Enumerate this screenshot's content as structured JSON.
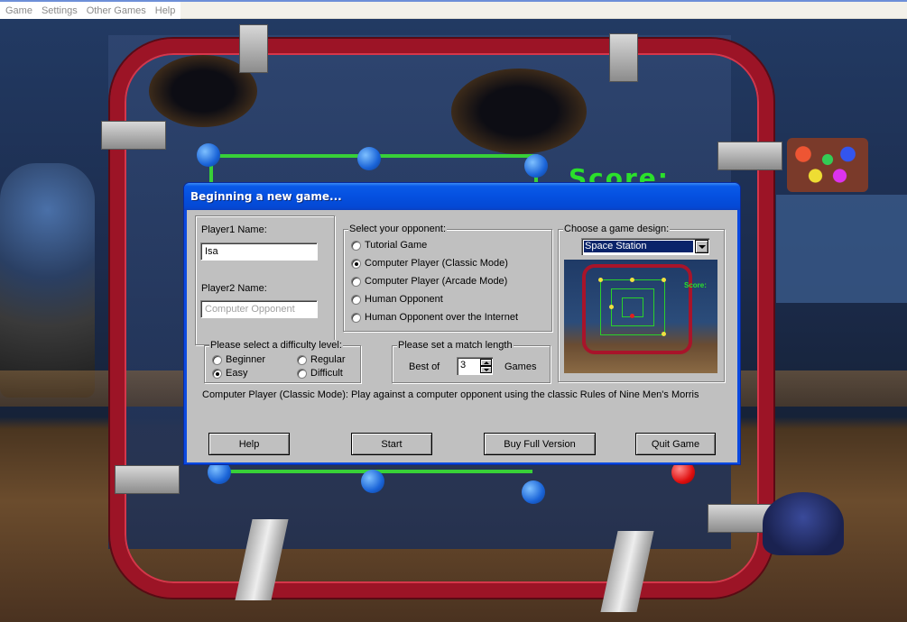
{
  "menu": {
    "items": [
      {
        "label": "Game"
      },
      {
        "label": "Settings"
      },
      {
        "label": "Other Games"
      },
      {
        "label": "Help"
      }
    ]
  },
  "background": {
    "scoreboard_text": "Score:"
  },
  "dialog": {
    "title": "Beginning a new game...",
    "player1_label": "Player1 Name:",
    "player1_value": "Isa",
    "player2_label": "Player2 Name:",
    "player2_placeholder": "Computer Opponent",
    "opponent": {
      "caption": "Select your opponent:",
      "options": [
        {
          "label": "Tutorial Game",
          "selected": false
        },
        {
          "label": "Computer Player (Classic Mode)",
          "selected": true
        },
        {
          "label": "Computer Player (Arcade Mode)",
          "selected": false
        },
        {
          "label": "Human Opponent",
          "selected": false
        },
        {
          "label": "Human Opponent over the Internet",
          "selected": false
        }
      ]
    },
    "design": {
      "caption": "Choose a game design:",
      "selected": "Space Station",
      "preview_text": "Score:"
    },
    "difficulty": {
      "caption": "Please select a difficulty level:",
      "options": [
        {
          "label": "Beginner",
          "selected": false
        },
        {
          "label": "Regular",
          "selected": false
        },
        {
          "label": "Easy",
          "selected": true
        },
        {
          "label": "Difficult",
          "selected": false
        }
      ]
    },
    "match": {
      "caption": "Please set a match length",
      "prefix": "Best of",
      "value": "3",
      "suffix": "Games"
    },
    "description": "Computer Player (Classic Mode): Play against a computer opponent using the classic Rules of Nine Men's Morris",
    "buttons": {
      "help": "Help",
      "start": "Start",
      "buy": "Buy Full Version",
      "quit": "Quit Game"
    }
  },
  "colors": {
    "title_bar": "#0550e0",
    "dialog_face": "#c0c0c0",
    "frame_red": "#9c1426",
    "board_green": "#38d038",
    "peg_blue": "#1a64d8"
  }
}
